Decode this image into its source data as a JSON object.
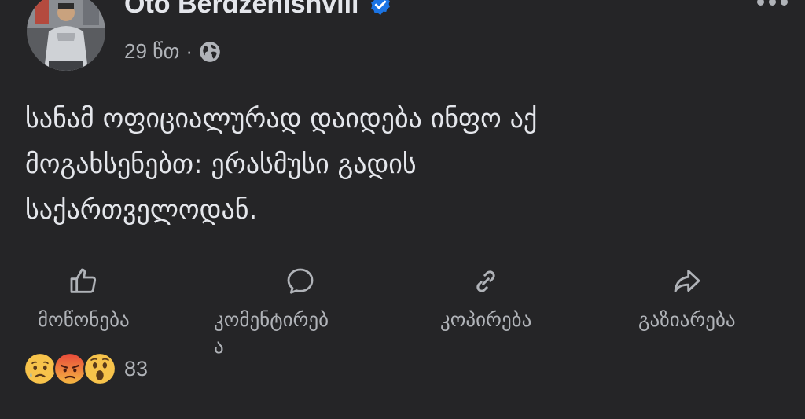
{
  "post": {
    "author": "Oto Berdzenishvili",
    "time": "29 წთ",
    "separator": "·",
    "privacy_icon": "globe-icon",
    "verified_icon": "verified-badge-icon",
    "text": "სანამ ოფიციალურად დაიდება ინფო აქ\nმოგახსენებთ: ერასმუსი გადის\nსაქართველოდან."
  },
  "actions": {
    "like": {
      "label": "მოწონება",
      "icon": "thumbs-up-icon"
    },
    "comment": {
      "label_line1": "კომენტირებ",
      "label_line2": "ა",
      "icon": "comment-bubble-icon"
    },
    "copy": {
      "label": "კოპირება",
      "icon": "link-icon"
    },
    "share": {
      "label": "გაზიარება",
      "icon": "share-arrow-icon"
    }
  },
  "reactions": {
    "icons": [
      "sad-emoji-icon",
      "angry-emoji-icon",
      "wow-emoji-icon"
    ],
    "count": "83"
  },
  "colors": {
    "background": "#252527",
    "primary_text": "#e4e6eb",
    "secondary_text": "#b0b3b8",
    "verified_blue": "#1b74e4"
  }
}
